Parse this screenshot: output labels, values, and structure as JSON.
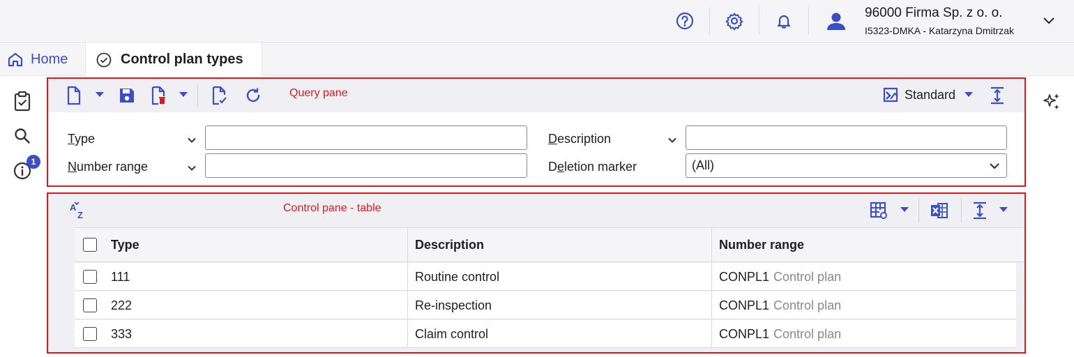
{
  "header": {
    "company": "96000  Firma Sp. z o. o.",
    "user": "I5323-DMKA - Katarzyna Dmitrzak",
    "icons": [
      "help-icon",
      "settings-icon",
      "bell-icon",
      "user-avatar-icon",
      "chevron-down-icon"
    ]
  },
  "tabs": {
    "home": "Home",
    "active": "Control plan types"
  },
  "query_pane": {
    "label": "Query pane",
    "view_label": "Standard",
    "fields": {
      "type_label_u": "T",
      "type_label_rest": "ype",
      "number_range_label_u": "N",
      "number_range_label_rest": "umber range",
      "description_label_u": "D",
      "description_label_rest": "escription",
      "deletion_label_pre": "D",
      "deletion_label_u": "e",
      "deletion_label_rest": "letion marker",
      "type_value": "",
      "number_range_value": "",
      "description_value": "",
      "deletion_marker_value": "(All)"
    }
  },
  "control_pane": {
    "label": "Control pane - table",
    "columns": [
      "Type",
      "Description",
      "Number range"
    ],
    "rows": [
      {
        "type": "111",
        "description": "Routine control",
        "nr_code": "CONPL1",
        "nr_name": "Control plan"
      },
      {
        "type": "222",
        "description": "Re-inspection",
        "nr_code": "CONPL1",
        "nr_name": "Control plan"
      },
      {
        "type": "333",
        "description": "Claim control",
        "nr_code": "CONPL1",
        "nr_name": "Control plan"
      }
    ]
  },
  "sidebar": {
    "info_badge": "1"
  },
  "colors": {
    "accent": "#3a4fc7",
    "highlight_border": "#e0161e"
  }
}
